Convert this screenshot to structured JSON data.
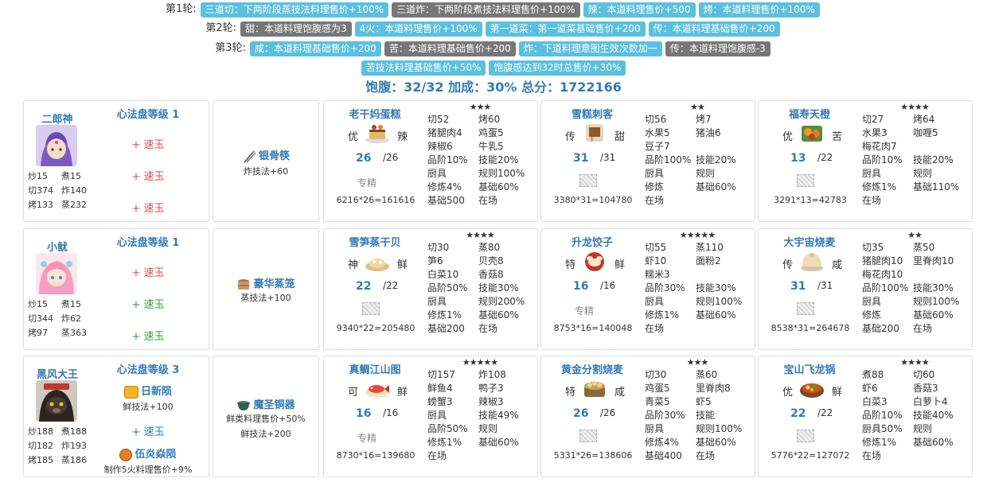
{
  "rounds": [
    {
      "label": "第1轮:",
      "badges": [
        {
          "text": "三道切：下两阶段蒸技法料理售价+100%",
          "style": "info"
        },
        {
          "text": "三道炸：下两阶段煮技法料理售价+100%",
          "style": "dark"
        },
        {
          "text": "辣：本道料理售价+500",
          "style": "info"
        },
        {
          "text": "烤：本道料理售价+100%",
          "style": "info"
        }
      ]
    },
    {
      "label": "第2轮:",
      "badges": [
        {
          "text": "甜：本道料理饱腹感为3",
          "style": "dark"
        },
        {
          "text": "4火：本道料理售价+100%",
          "style": "info"
        },
        {
          "text": "第一道菜：第一道菜基础售价+200",
          "style": "info"
        },
        {
          "text": "传：本道料理基础售价+200",
          "style": "info"
        }
      ]
    },
    {
      "label": "第3轮:",
      "badges": [
        {
          "text": "咸：本道料理基础售价+200",
          "style": "info"
        },
        {
          "text": "苦：本道料理基础售价+200",
          "style": "dark"
        },
        {
          "text": "炸：下道料理意图生效次数加一",
          "style": "info"
        },
        {
          "text": "传：本道料理饱腹感-3",
          "style": "dark"
        }
      ]
    },
    {
      "label": "",
      "badges": [
        {
          "text": "苦技法料理基础售价+50%",
          "style": "info"
        },
        {
          "text": "饱腹感达到32时总售价+30%",
          "style": "info"
        }
      ]
    }
  ],
  "summary": "饱腹：32/32 加成：30% 总分：1722166",
  "colors": {
    "accent": "#337ab7",
    "badge_info": "#5bc0de",
    "badge_dark": "#777777",
    "red": "#d9534f",
    "green": "#3c9c3c"
  },
  "rows": [
    {
      "chef": {
        "name": "二郎神",
        "avatar": "erlangshen-avatar",
        "stats": [
          [
            "炒15",
            "煮15"
          ],
          [
            "切374",
            "炸140"
          ],
          [
            "烤133",
            "蒸232"
          ]
        ],
        "heart_title": "心法盘等级 1",
        "gems": [
          {
            "text": "+ 速玉",
            "color": "red"
          },
          {
            "text": "+ 速玉",
            "color": "red"
          },
          {
            "text": "+ 速玉",
            "color": "red"
          }
        ]
      },
      "equip": {
        "name": "银骨筷",
        "icon": "chopsticks-icon",
        "effects": [
          "炸技法+60"
        ]
      },
      "recipes": [
        {
          "name": "老干妈蛋糕",
          "stars": "★★★",
          "rarity": "优",
          "taste": "辣",
          "qty": "26",
          "max": "/26",
          "spec": "专精",
          "spec_placeholder": false,
          "calc": "6216*26=161616",
          "grid": [
            [
              "切52",
              "烤60"
            ],
            [
              "猪腿肉4",
              "鸡蛋5"
            ],
            [
              "辣椒6",
              "牛乳5"
            ],
            [
              "品阶10%",
              "技能20%"
            ],
            [
              "厨具",
              "规则100%"
            ],
            [
              "修炼4%",
              "基础60%"
            ],
            [
              "基础500",
              "在场"
            ]
          ]
        },
        {
          "name": "雪糕刺客",
          "stars": "★★",
          "rarity": "传",
          "taste": "甜",
          "qty": "31",
          "max": "/31",
          "spec": "",
          "spec_placeholder": true,
          "calc": "3380*31=104780",
          "grid": [
            [
              "切56",
              "烤7"
            ],
            [
              "水果5",
              "猪油6"
            ],
            [
              "豆子7",
              ""
            ],
            [
              "品阶100%",
              "技能20%"
            ],
            [
              "厨具",
              "规则"
            ],
            [
              "修炼",
              "基础60%"
            ],
            [
              "在场",
              ""
            ]
          ]
        },
        {
          "name": "福寿天橙",
          "stars": "★★★★",
          "rarity": "优",
          "taste": "苦",
          "qty": "13",
          "max": "/22",
          "spec": "",
          "spec_placeholder": true,
          "calc": "3291*13=42783",
          "grid": [
            [
              "切27",
              "烤64"
            ],
            [
              "水果3",
              "咖喱5"
            ],
            [
              "梅花肉7",
              ""
            ],
            [
              "品阶10%",
              "技能20%"
            ],
            [
              "厨具",
              "规则"
            ],
            [
              "修炼1%",
              "基础110%"
            ],
            [
              "在场",
              ""
            ]
          ]
        }
      ]
    },
    {
      "chef": {
        "name": "小鱿",
        "avatar": "xiaoyou-avatar",
        "stats": [
          [
            "炒15",
            "煮15"
          ],
          [
            "切344",
            "炸62"
          ],
          [
            "烤97",
            "蒸363"
          ]
        ],
        "heart_title": "心法盘等级 1",
        "gems": [
          {
            "text": "+ 速玉",
            "color": "red"
          },
          {
            "text": "+ 速玉",
            "color": "green"
          },
          {
            "text": "+ 速玉",
            "color": "green"
          }
        ]
      },
      "equip": {
        "name": "豪华蒸笼",
        "icon": "steamer-icon",
        "effects": [
          "蒸技法+100"
        ]
      },
      "recipes": [
        {
          "name": "雪笋蒸干贝",
          "stars": "★★★★",
          "rarity": "神",
          "taste": "鲜",
          "qty": "22",
          "max": "/22",
          "spec": "",
          "spec_placeholder": true,
          "calc": "9340*22=205480",
          "grid": [
            [
              "切30",
              "蒸80"
            ],
            [
              "笋6",
              "贝壳8"
            ],
            [
              "白菜10",
              "香菇8"
            ],
            [
              "品阶50%",
              "技能30%"
            ],
            [
              "厨具",
              "规则200%"
            ],
            [
              "修炼1%",
              "基础60%"
            ],
            [
              "基础200",
              "在场"
            ]
          ]
        },
        {
          "name": "升龙饺子",
          "stars": "★★★★★",
          "rarity": "特",
          "taste": "鲜",
          "qty": "16",
          "max": "/16",
          "spec": "专精",
          "spec_placeholder": false,
          "calc": "8753*16=140048",
          "grid": [
            [
              "切55",
              "蒸110"
            ],
            [
              "虾10",
              "面粉2"
            ],
            [
              "糯米3",
              ""
            ],
            [
              "品阶30%",
              "技能30%"
            ],
            [
              "厨具",
              "规则100%"
            ],
            [
              "修炼1%",
              "基础60%"
            ],
            [
              "在场",
              ""
            ]
          ]
        },
        {
          "name": "大宇宙烧麦",
          "stars": "★★",
          "rarity": "传",
          "taste": "咸",
          "qty": "31",
          "max": "/31",
          "spec": "",
          "spec_placeholder": true,
          "calc": "8538*31=264678",
          "grid": [
            [
              "切35",
              "蒸50"
            ],
            [
              "猪腿肉10",
              "里脊肉10"
            ],
            [
              "梅花肉10",
              ""
            ],
            [
              "品阶100%",
              "技能30%"
            ],
            [
              "厨具",
              "规则100%"
            ],
            [
              "修炼",
              "基础60%"
            ],
            [
              "基础200",
              "在场"
            ]
          ]
        }
      ]
    },
    {
      "chef": {
        "name": "黑风大王",
        "avatar": "heifengdawang-avatar",
        "stats": [
          [
            "炒188",
            "煮188"
          ],
          [
            "切182",
            "炸193"
          ],
          [
            "烤185",
            "蒸186"
          ]
        ],
        "heart_title": "心法盘等级 3",
        "ambers": [
          {
            "name": "日新陨",
            "icon": "sun-amber-icon",
            "effect": "鲜技法+100"
          },
          {
            "name": "伍炎焱陨",
            "icon": "fire-amber-icon",
            "effect": "制作5火料理售价+9%"
          }
        ],
        "gem_mid": {
          "text": "+ 速玉",
          "color": "blue"
        }
      },
      "equip": {
        "name": "魔圣铜器",
        "icon": "bronze-vessel-icon",
        "effects": [
          "鲜类料理售价+50%",
          "鲜技法+200"
        ]
      },
      "recipes": [
        {
          "name": "真鲷江山图",
          "stars": "★★★★★",
          "rarity": "可",
          "taste": "鲜",
          "qty": "16",
          "max": "/16",
          "spec": "专精",
          "spec_placeholder": false,
          "calc": "8730*16=139680",
          "grid": [
            [
              "切157",
              "炸108"
            ],
            [
              "鲜鱼4",
              "鸭子3"
            ],
            [
              "螃蟹3",
              "辣椒3"
            ],
            [
              "厨具",
              "技能49%"
            ],
            [
              "品阶50%",
              "规则"
            ],
            [
              "修炼1%",
              "基础60%"
            ],
            [
              "在场",
              ""
            ]
          ]
        },
        {
          "name": "黄金分割烧麦",
          "stars": "★★★",
          "rarity": "特",
          "taste": "咸",
          "qty": "26",
          "max": "/26",
          "spec": "",
          "spec_placeholder": true,
          "calc": "5331*26=138606",
          "grid": [
            [
              "切30",
              "蒸60"
            ],
            [
              "鸡蛋5",
              "里脊肉8"
            ],
            [
              "青菜5",
              "虾5"
            ],
            [
              "品阶30%",
              "技能"
            ],
            [
              "厨具",
              "规则100%"
            ],
            [
              "修炼4%",
              "基础60%"
            ],
            [
              "基础400",
              "在场"
            ]
          ]
        },
        {
          "name": "宝山飞龙锅",
          "stars": "★★★★",
          "rarity": "优",
          "taste": "鲜",
          "qty": "22",
          "max": "/22",
          "spec": "",
          "spec_placeholder": true,
          "calc": "5776*22=127072",
          "grid": [
            [
              "煮88",
              "切60"
            ],
            [
              "虾6",
              "香菇3"
            ],
            [
              "白菜3",
              "白萝卜4"
            ],
            [
              "品阶10%",
              "技能40%"
            ],
            [
              "厨具50%",
              "规则"
            ],
            [
              "修炼1%",
              "基础60%"
            ],
            [
              "在场",
              ""
            ]
          ]
        }
      ]
    }
  ]
}
